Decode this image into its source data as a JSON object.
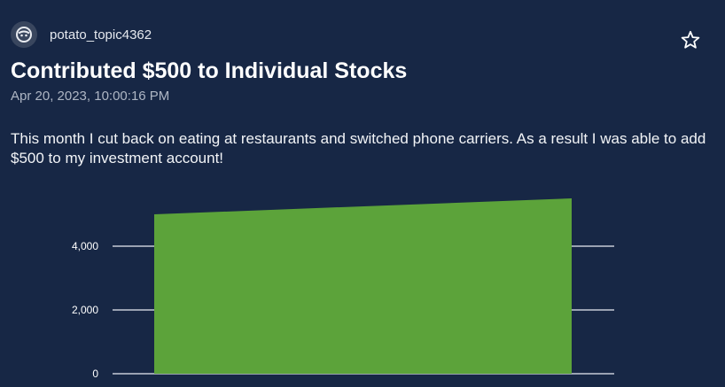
{
  "post": {
    "username": "potato_topic4362",
    "title": "Contributed $500 to Individual Stocks",
    "timestamp": "Apr 20, 2023, 10:00:16 PM",
    "body": "This month I cut back on eating at restaurants and switched phone carriers. As a result I was able to add $500 to my investment account!"
  },
  "icons": {
    "avatar": "avatar-face-icon",
    "favorite": "star-outline-icon"
  },
  "colors": {
    "background": "#172745",
    "area_fill": "#5ca33a"
  },
  "chart_data": {
    "type": "area",
    "x": [
      0,
      1
    ],
    "series": [
      {
        "values": [
          5000,
          5500
        ]
      }
    ],
    "yticks": [
      0,
      2000,
      4000
    ],
    "ytick_labels": [
      "0",
      "2,000",
      "4,000"
    ],
    "ylim": [
      0,
      6000
    ],
    "grid": true,
    "title": "",
    "xlabel": "",
    "ylabel": ""
  }
}
